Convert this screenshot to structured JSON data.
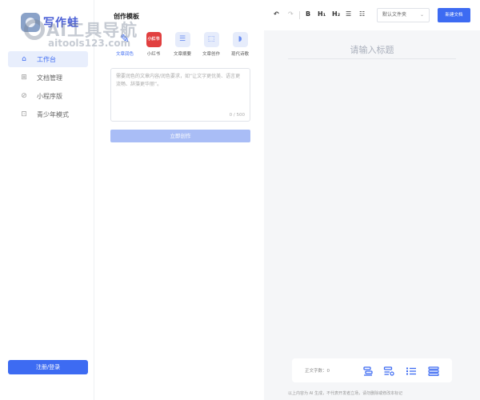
{
  "sidebar": {
    "logo_text": "写作蛙",
    "items": [
      {
        "label": "工作台",
        "icon": "home-icon",
        "active": true
      },
      {
        "label": "文档管理",
        "icon": "document-grid-icon",
        "active": false
      },
      {
        "label": "小程序版",
        "icon": "miniprogram-icon",
        "active": false
      },
      {
        "label": "青少年模式",
        "icon": "youth-mode-icon",
        "active": false
      }
    ],
    "login_label": "注册/登录"
  },
  "watermark": {
    "main": "AI工具导航",
    "sub": "aitools123.com"
  },
  "panel": {
    "title": "创作模板",
    "templates": [
      {
        "label": "文章润色",
        "icon": "pen-icon",
        "icon_text": "✎",
        "active": true
      },
      {
        "label": "小红书",
        "icon": "xiaohongshu-icon",
        "icon_text": "小红书",
        "active": false
      },
      {
        "label": "文章摘要",
        "icon": "summary-icon",
        "icon_text": "☰",
        "active": false
      },
      {
        "label": "文章创作",
        "icon": "create-icon",
        "icon_text": "⬚",
        "active": false
      },
      {
        "label": "现代诗歌",
        "icon": "poetry-icon",
        "icon_text": "◗",
        "active": false
      }
    ],
    "textarea": {
      "placeholder": "需要润色的文章内容/润色要求，如“让文字更优美、语言更流畅、辞藻更华丽”。",
      "count": "0 / 500"
    },
    "create_label": "立即创作"
  },
  "toolbar": {
    "undo": "↶",
    "redo": "↷",
    "bold": "B",
    "h1": "H₁",
    "h2": "H₂",
    "bullet_list": "☰",
    "ordered_list": "☷",
    "folder_value": "默认文件夹",
    "new_doc_label": "新建文档"
  },
  "editor": {
    "title_placeholder": "请输入标题",
    "word_count_label": "正文字数：",
    "word_count": "0",
    "footer_note": "以上内容为 AI 生成，不代表开发者立场，请勿删除或修改本标记"
  },
  "colors": {
    "accent": "#3d6bf2",
    "accent_light": "#a9bdf6",
    "editor_bg": "#f5f6f8"
  }
}
